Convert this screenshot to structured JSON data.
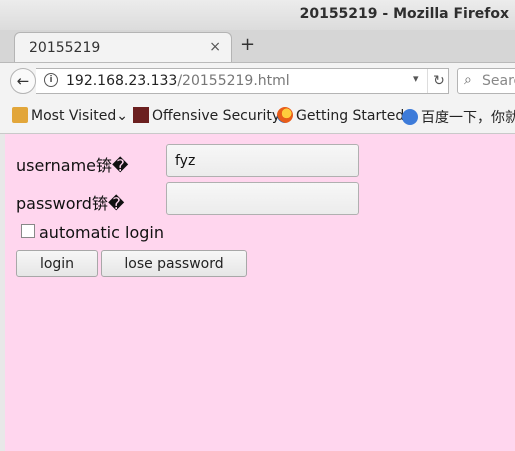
{
  "window": {
    "title": "20155219 - Mozilla Firefox"
  },
  "tab": {
    "label": "20155219",
    "close": "×",
    "new_tab": "+"
  },
  "navbar": {
    "back": "←",
    "info": "i",
    "url_host": "192.168.23.133",
    "url_path": "/20155219.html",
    "dropdown": "▾",
    "reload": "↻",
    "search_placeholder": "Searc"
  },
  "bookmarks": [
    {
      "label": "Most Visited",
      "icon": "folder-icon",
      "chevron": "⌄"
    },
    {
      "label": "Offensive Security",
      "icon": "offensive-security-icon"
    },
    {
      "label": "Getting Started",
      "icon": "firefox-icon"
    },
    {
      "label": "百度一下，你就",
      "icon": "baidu-icon"
    }
  ],
  "form": {
    "username_label": "username锛�",
    "username_value": "fyz",
    "password_label": "password锛�",
    "password_value": "",
    "remember_label": "automatic login",
    "login_button": "login",
    "lose_password_button": "lose password"
  },
  "colors": {
    "page_background": "#ffd6ee",
    "chrome": "#f3f3f3"
  }
}
